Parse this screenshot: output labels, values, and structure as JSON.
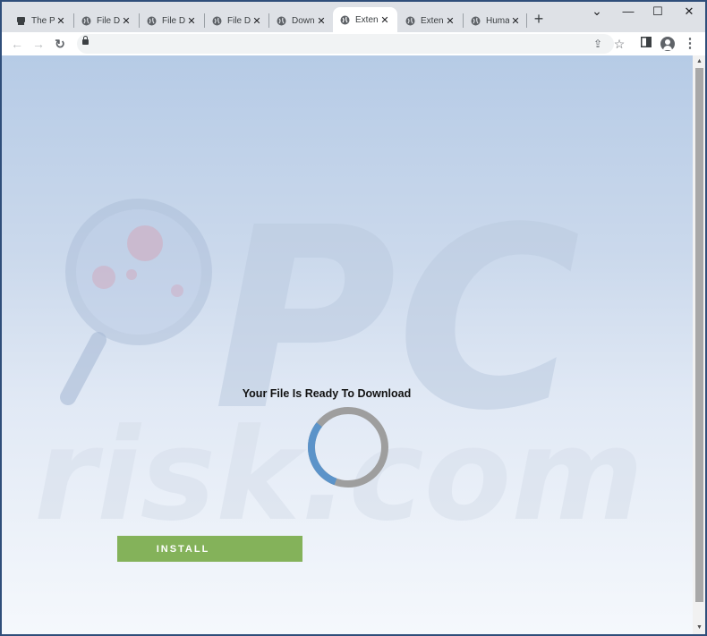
{
  "tabs": [
    {
      "title": "The Pi",
      "favicon": "document-icon"
    },
    {
      "title": "File Do",
      "favicon": "globe-icon"
    },
    {
      "title": "File Do",
      "favicon": "globe-icon"
    },
    {
      "title": "File Do",
      "favicon": "globe-icon"
    },
    {
      "title": "Down",
      "favicon": "globe-icon"
    },
    {
      "title": "Extens",
      "favicon": "globe-icon",
      "active": true
    },
    {
      "title": "Extens",
      "favicon": "globe-icon"
    },
    {
      "title": "Huma",
      "favicon": "globe-icon"
    }
  ],
  "glyphs": {
    "close": "✕",
    "new_tab": "+",
    "minimize": "—",
    "maximize": "☐",
    "window_close": "✕",
    "chevron": "⌄",
    "back": "←",
    "forward": "→",
    "reload": "↻",
    "share": "⇪",
    "star": "☆",
    "sidepanel": "▮",
    "menu": "⋮",
    "scroll_up": "▲",
    "scroll_down": "▼"
  },
  "page": {
    "heading": "Your File Is Ready To Download",
    "button_label": "INSTALL",
    "watermark_text": "risk.com",
    "watermark_logo": "PC"
  },
  "colors": {
    "button": "#84b25a",
    "spinner_track": "#9e9e9e",
    "spinner_arc": "#5b93c9"
  },
  "spinner_progress": 0.3
}
